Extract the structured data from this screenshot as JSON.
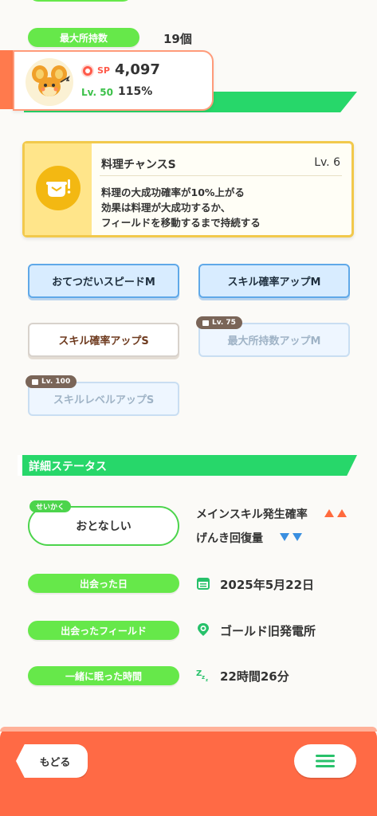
{
  "stats": {
    "max_label": "最大所持数",
    "max_value": "19個"
  },
  "pokemon": {
    "sp_label": "SP",
    "sp_value": "4,097",
    "level": "Lv. 50",
    "percent": "115%"
  },
  "main_skill": {
    "name": "料理チャンスS",
    "level": "Lv. 6",
    "desc_line1": "料理の大成功確率が10%上がる",
    "desc_line2": "効果は料理が大成功するか、",
    "desc_line3": "フィールドを移動するまで持続する"
  },
  "sub_skills": [
    {
      "label": "おてつだいスピードM"
    },
    {
      "label": "スキル確率アップM"
    },
    {
      "label": "スキル確率アップS"
    },
    {
      "label": "最大所持数アップM",
      "lock": "Lv. 75"
    },
    {
      "label": "スキルレベルアップS",
      "lock": "Lv. 100"
    }
  ],
  "details": {
    "title": "詳細ステータス",
    "nature_tag": "せいかく",
    "nature": "おとなしい",
    "up_effect": "メインスキル発生確率",
    "down_effect": "げんき回復量",
    "met_date_label": "出会った日",
    "met_date": "2025年5月22日",
    "met_field_label": "出会ったフィールド",
    "met_field": "ゴールド旧発電所",
    "slept_label": "一緒に眠った時間",
    "slept_time": "22時間26分"
  },
  "footer": {
    "back_label": "もどる"
  },
  "colors": {
    "accent_green": "#27d76a",
    "pill_green": "#66e84a",
    "footer_orange": "#ff6a45",
    "up_arrow": "#ff6a3d",
    "down_arrow": "#3a8fe0"
  }
}
